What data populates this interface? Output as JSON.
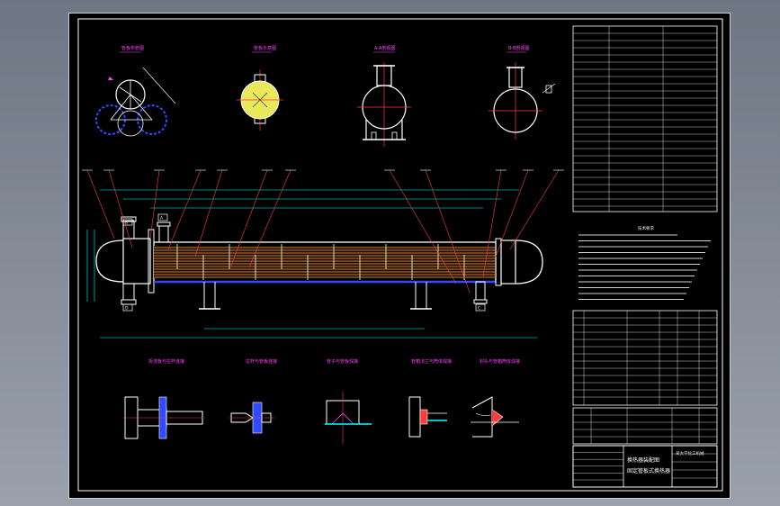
{
  "drawing": {
    "top_view_labels": [
      "管板布管图",
      "管板示意图",
      "A-A剖视图",
      "B-B剖视图"
    ],
    "detail_view_labels": [
      "折流板与拉杆连接",
      "拉杆与管板连接",
      "管子与管板焊接",
      "管箱法兰与筒体焊接",
      "封头与管箱筒体焊接"
    ],
    "nozzle_tags": [
      "B",
      "A",
      "D",
      "C"
    ],
    "title_block": {
      "drawing_name": "换热器装配图",
      "subtitle": "固定管板式换热器",
      "school": "某大学化工机械"
    },
    "notes_heading": "技术要求"
  },
  "colors": {
    "background": "#000000",
    "line_white": "#ffffff",
    "line_cyan": "#00ffff",
    "line_red": "#ff3b3b",
    "line_orange": "#ff9a3c",
    "line_blue": "#2f4bff",
    "label_magenta": "#ff40ff",
    "fill_yellow": "#e8e85a"
  }
}
